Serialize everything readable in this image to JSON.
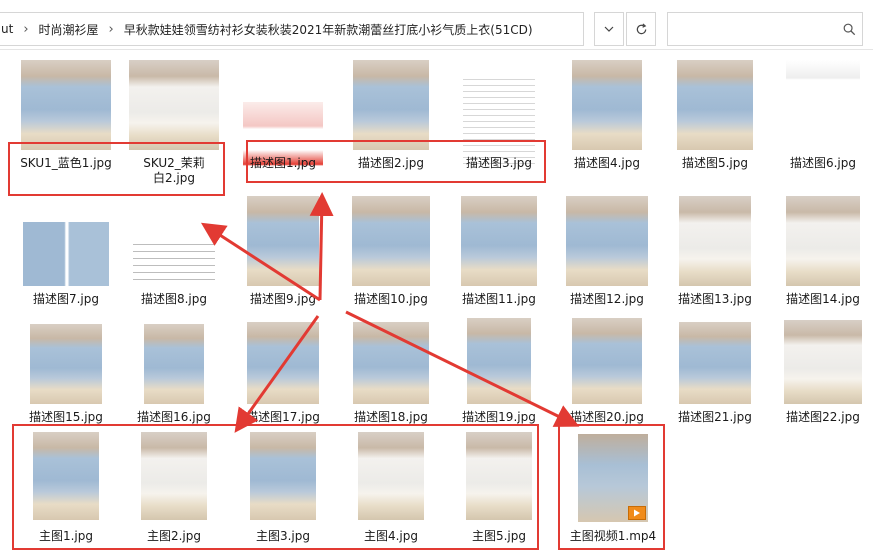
{
  "address_bar": {
    "breadcrumbs": [
      "ut",
      "时尚潮衫屋",
      "早秋款娃娃领雪纺衬衫女装秋装2021年新款潮蕾丝打底小衫气质上衣(51CD)"
    ],
    "separator": "›",
    "dropdown_icon": "chevron-down-icon",
    "refresh_icon": "refresh-icon",
    "search_icon": "search-icon"
  },
  "files": [
    {
      "name": "SKU1_蓝色1.jpg",
      "style": "ph-blue"
    },
    {
      "name": "SKU2_茉莉白2.jpg",
      "style": "ph-white"
    },
    {
      "name": "描述图1.jpg",
      "style": "ph-shop"
    },
    {
      "name": "描述图2.jpg",
      "style": "ph-blue"
    },
    {
      "name": "描述图3.jpg",
      "style": "ph-text"
    },
    {
      "name": "描述图4.jpg",
      "style": "ph-blue"
    },
    {
      "name": "描述图5.jpg",
      "style": "ph-blue"
    },
    {
      "name": "描述图6.jpg",
      "style": "ph-size"
    },
    {
      "name": "描述图7.jpg",
      "style": "ph-sep"
    },
    {
      "name": "描述图8.jpg",
      "style": "ph-table"
    },
    {
      "name": "描述图9.jpg",
      "style": "ph-blue"
    },
    {
      "name": "描述图10.jpg",
      "style": "ph-blue"
    },
    {
      "name": "描述图11.jpg",
      "style": "ph-blue"
    },
    {
      "name": "描述图12.jpg",
      "style": "ph-blue"
    },
    {
      "name": "描述图13.jpg",
      "style": "ph-white"
    },
    {
      "name": "描述图14.jpg",
      "style": "ph-white"
    },
    {
      "name": "描述图15.jpg",
      "style": "ph-blue"
    },
    {
      "name": "描述图16.jpg",
      "style": "ph-blue"
    },
    {
      "name": "描述图17.jpg",
      "style": "ph-blue"
    },
    {
      "name": "描述图18.jpg",
      "style": "ph-blue"
    },
    {
      "name": "描述图19.jpg",
      "style": "ph-blue"
    },
    {
      "name": "描述图20.jpg",
      "style": "ph-blue"
    },
    {
      "name": "描述图21.jpg",
      "style": "ph-blue"
    },
    {
      "name": "描述图22.jpg",
      "style": "ph-white"
    },
    {
      "name": "主图1.jpg",
      "style": "ph-blue"
    },
    {
      "name": "主图2.jpg",
      "style": "ph-white"
    },
    {
      "name": "主图3.jpg",
      "style": "ph-blue"
    },
    {
      "name": "主图4.jpg",
      "style": "ph-white"
    },
    {
      "name": "主图5.jpg",
      "style": "ph-white"
    },
    {
      "name": "主图视频1.mp4",
      "style": "ph-video",
      "badge_icon": "play-icon"
    }
  ],
  "colors": {
    "annotation_red": "#e23a33",
    "video_badge": "#f08b1a"
  }
}
